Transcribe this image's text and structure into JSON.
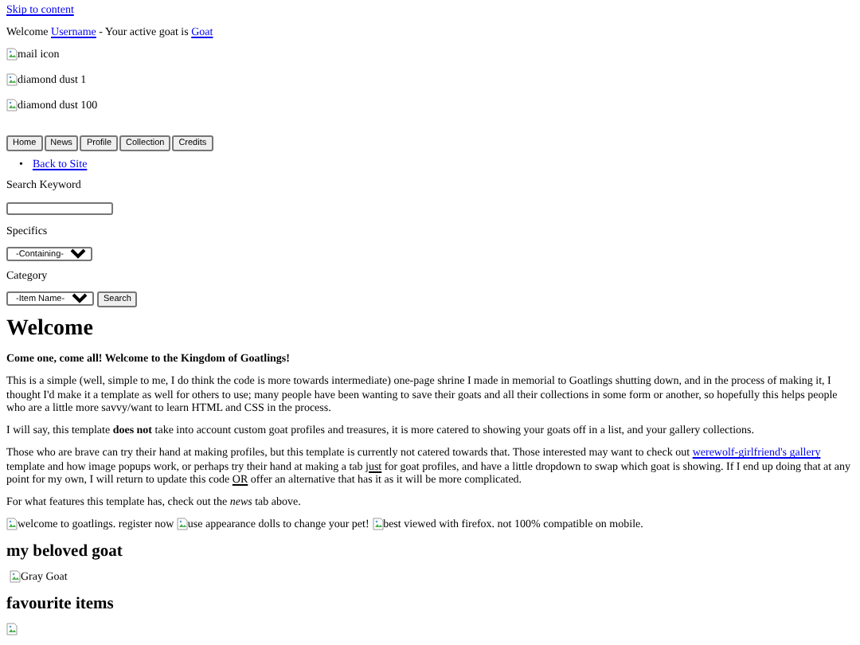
{
  "skip_link": "Skip to content",
  "welcome_line": [
    {
      "kind": "text",
      "text": "Welcome "
    },
    {
      "kind": "link",
      "text": "Username"
    },
    {
      "kind": "text",
      "text": " - Your active goat is "
    },
    {
      "kind": "link",
      "text": "Goat"
    }
  ],
  "header_images": [
    {
      "alt": "mail icon"
    },
    {
      "alt": "diamond dust 1"
    },
    {
      "alt": "diamond dust 100"
    }
  ],
  "nav_buttons": [
    "Home",
    "News",
    "Profile",
    "Collection",
    "Credits"
  ],
  "sidebar_links": [
    {
      "bullet": "•",
      "label": "Back to Site"
    }
  ],
  "search": {
    "keyword_label": "Search Keyword",
    "specifics_label": "Specifics",
    "specifics_value": "-Containing-",
    "category_label": "Category",
    "category_value": "-Item Name-",
    "button": "Search"
  },
  "content": {
    "title": "Welcome",
    "subtitle": "Come one, come all! Welcome to the Kingdom of Goatlings!",
    "paragraphs": [
      [
        {
          "kind": "text",
          "text": "This is a simple (well, simple to me, I do think the code is more towards intermediate) one-page shrine I made in memorial to Goatlings shutting down, and in the process of making it, I thought I'd make it a template as well for others to use; many people have been wanting to save their goats and all their collections in some form or another, so hopefully this helps people who are a little more savvy/want to learn HTML and CSS in the process."
        }
      ],
      [
        {
          "kind": "text",
          "text": "I will say, this template **does not** take into account custom goat profiles and treasures, it is more catered to showing your goats off in a list, and your gallery collections."
        }
      ],
      [
        {
          "kind": "text",
          "text": "Those who are brave can try their hand at making profiles, but this template is currently not catered towards that. Those interested may want to check out "
        },
        {
          "kind": "link",
          "text": "werewolf-girlfriend's gallery"
        },
        {
          "kind": "text",
          "text": " template and how image popups work, or perhaps try their hand at making a tab "
        },
        {
          "kind": "underline",
          "text": "just"
        },
        {
          "kind": "text",
          "text": " for goat profiles, and have a little dropdown to swap which goat is showing. If I end up doing that at any point for my own, I will return to update this code "
        },
        {
          "kind": "underline",
          "text": "OR"
        },
        {
          "kind": "text",
          "text": " offer an alternative that has it as it will be more complicated."
        }
      ],
      [
        {
          "kind": "text",
          "text": "For what features this template has, check out the *news* tab above."
        }
      ]
    ],
    "banners": [
      {
        "alt": "welcome to goatlings. register now"
      },
      {
        "alt": "use appearance dolls to change your pet!"
      },
      {
        "alt": "best viewed with firefox. not 100% compatible on mobile."
      }
    ],
    "goat_heading": "my beloved goat",
    "goat_image": {
      "alt": "Gray Goat"
    },
    "items_heading": "favourite items",
    "item_images": [
      {
        "kind": "broken"
      }
    ]
  }
}
